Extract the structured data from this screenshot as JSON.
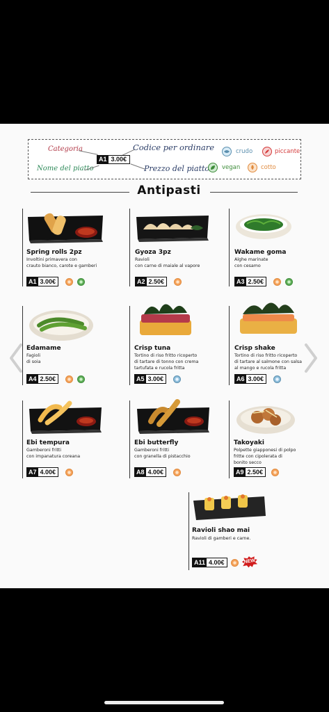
{
  "legend": {
    "category_label": "Categoria",
    "order_code_label": "Codice per ordinare",
    "dish_name_label": "Nome del piatto",
    "dish_price_label": "Prezzo del piatto",
    "sample_code": "A1",
    "sample_price": "3.00€",
    "icons": [
      {
        "icon": "raw-icon",
        "label": "crudo",
        "color": "#5b8fae"
      },
      {
        "icon": "spicy-icon",
        "label": "piccante",
        "color": "#d43a3a"
      },
      {
        "icon": "vegan-icon",
        "label": "vegan",
        "color": "#3e8c3a"
      },
      {
        "icon": "cooked-icon",
        "label": "cotto",
        "color": "#e08a3d"
      }
    ]
  },
  "section_title": "Antipasti",
  "items": [
    {
      "name": "Spring rolls 2pz",
      "description": "Involtini primavera con\ncrauto bianco, carote e gamberi",
      "code": "A1",
      "price": "3.00€",
      "tags": [
        "cooked",
        "vegan"
      ]
    },
    {
      "name": "Gyoza 3pz",
      "description": "Ravioli\ncon carne di maiale al vapore",
      "code": "A2",
      "price": "2.50€",
      "tags": [
        "cooked"
      ]
    },
    {
      "name": "Wakame goma",
      "description": "Alghe marinate\ncon cesamo",
      "code": "A3",
      "price": "2.50€",
      "tags": [
        "cooked",
        "vegan"
      ]
    },
    {
      "name": "Edamame",
      "description": "Fagioli\ndi soia",
      "code": "A4",
      "price": "2.50€",
      "tags": [
        "cooked",
        "vegan"
      ]
    },
    {
      "name": "Crisp tuna",
      "description": "Tortino di riso fritto ricoperto\ndi tartare di tonno con crema\ntartufata e rucola fritta",
      "code": "A5",
      "price": "3.00€",
      "tags": [
        "raw"
      ]
    },
    {
      "name": "Crisp shake",
      "description": "Tortino di riso fritto ricoperto\ndi tartare al salmone con salsa\nal mango e rucola fritta",
      "code": "A6",
      "price": "3.00€",
      "tags": [
        "raw"
      ]
    },
    {
      "name": "Ebi tempura",
      "description": "Gamberoni fritti\ncon impanatura coreana",
      "code": "A7",
      "price": "4.00€",
      "tags": [
        "cooked"
      ]
    },
    {
      "name": "Ebi butterfly",
      "description": "Gamberoni fritti\ncon granella di pistacchio",
      "code": "A8",
      "price": "4.00€",
      "tags": [
        "cooked"
      ]
    },
    {
      "name": "Takoyaki",
      "description": "Polpette giapponesi di polpo\nfritte con cipolerata di\nbonito secco",
      "code": "A9",
      "price": "2.50€",
      "tags": [
        "cooked"
      ]
    },
    {
      "name": "Ravioli shao mai",
      "description": "Ravioli di gamberi e carne.",
      "code": "A11",
      "price": "4.00€",
      "tags": [
        "cooked",
        "new"
      ],
      "new_badge": "NEW"
    }
  ],
  "colors": {
    "category": "#b23a48",
    "dish_name": "#2f8a5a",
    "code_label": "#2a3c66"
  }
}
